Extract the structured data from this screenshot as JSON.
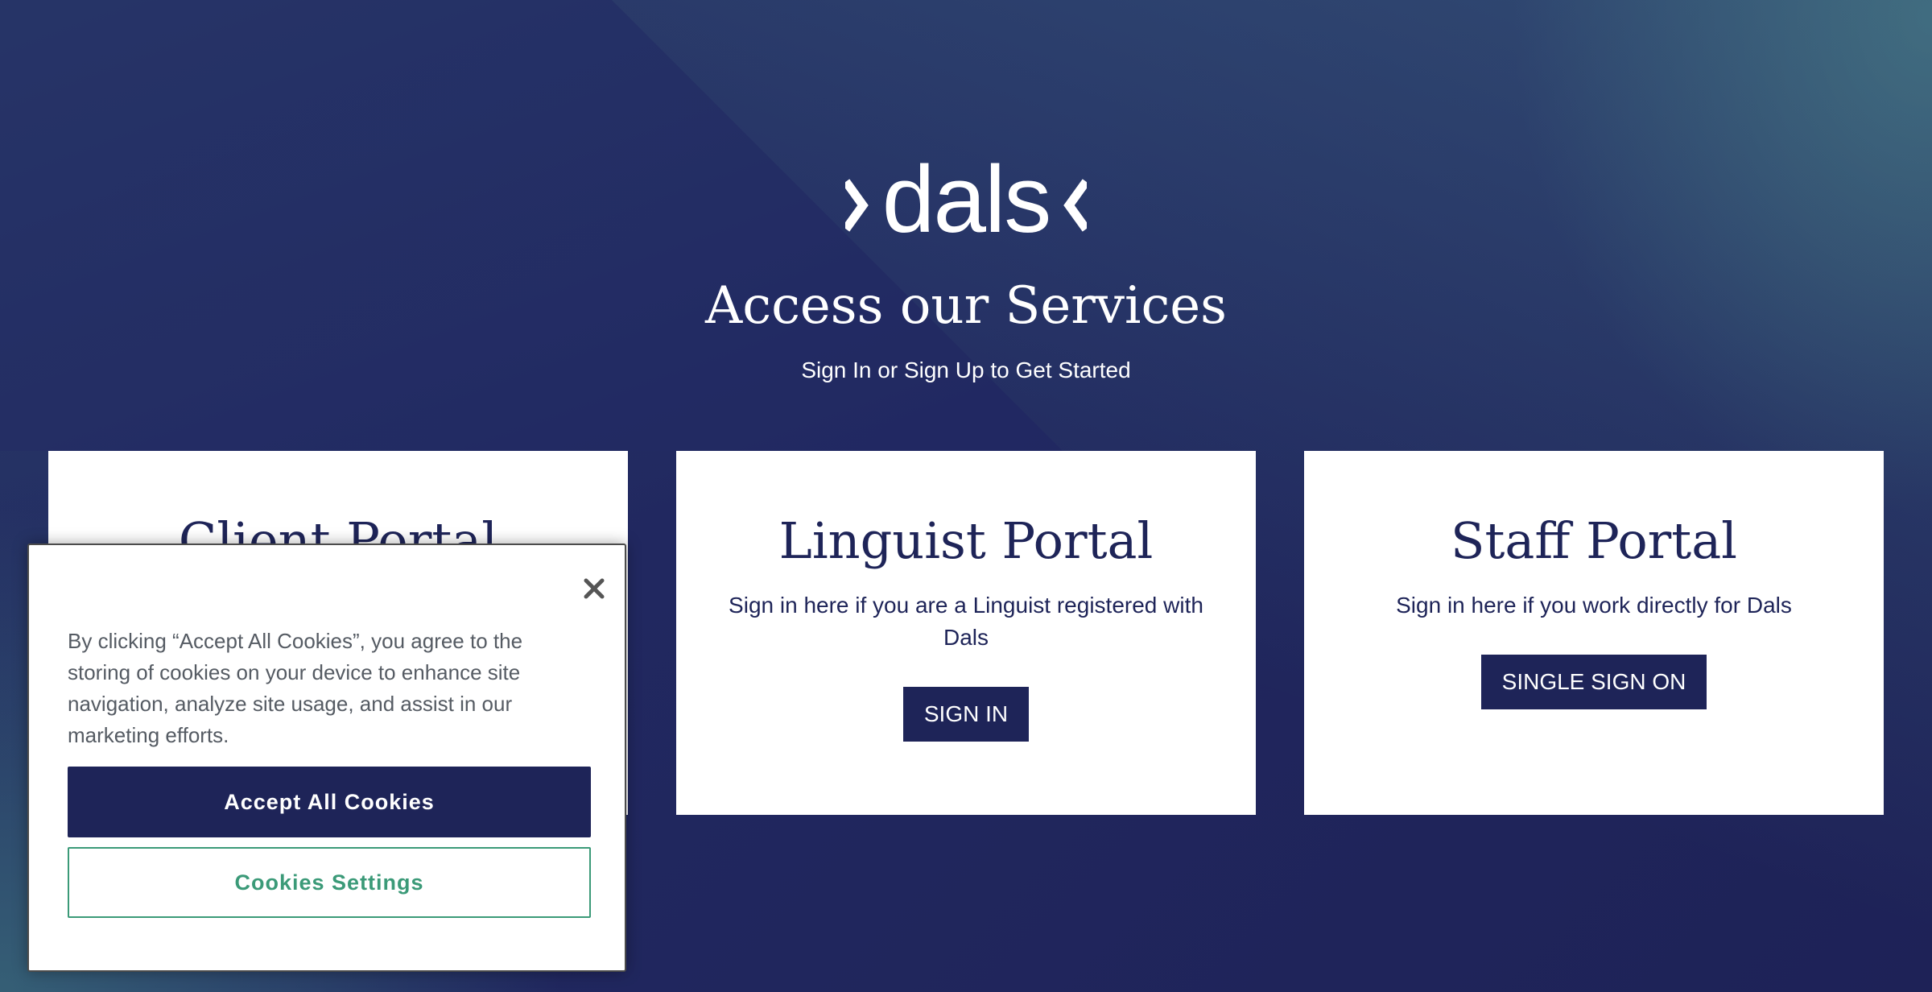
{
  "brand": {
    "logo_text": "›dals‹",
    "colors": {
      "navy": "#1e2458",
      "background": "#202659",
      "accent_green": "#3b9a78",
      "white": "#ffffff"
    }
  },
  "hero": {
    "title": "Access our Services",
    "subtitle": "Sign In or Sign Up to Get Started"
  },
  "cards": {
    "client": {
      "title": "Client Portal"
    },
    "linguist": {
      "title": "Linguist Portal",
      "text": "Sign in here if you are a Linguist registered with Dals",
      "button_label": "SIGN IN"
    },
    "staff": {
      "title": "Staff Portal",
      "text": "Sign in here if you work directly for Dals",
      "button_label": "SINGLE SIGN ON"
    }
  },
  "cookie_banner": {
    "text": "By clicking “Accept All Cookies”, you agree to the storing of cookies on your device to enhance site navigation, analyze site usage, and assist in our marketing efforts.",
    "accept_label": "Accept All Cookies",
    "settings_label": "Cookies Settings",
    "close_icon": "close-icon"
  }
}
